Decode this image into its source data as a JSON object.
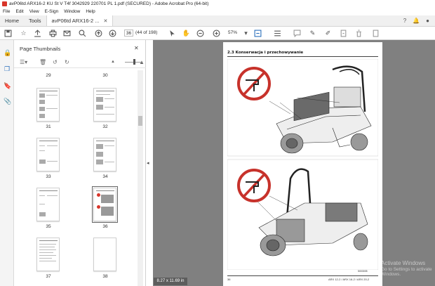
{
  "window": {
    "title": "avP06td ARX16-2 KU St V T4f 3042929 220701 PL 1.pdf (SECURED) - Adobe Acrobat Pro (64-bit)"
  },
  "menu": [
    "File",
    "Edit",
    "View",
    "E-Sign",
    "Window",
    "Help"
  ],
  "tabs": [
    {
      "label": "Home"
    },
    {
      "label": "Tools"
    },
    {
      "label": "avP06td ARX16-2 ..."
    }
  ],
  "toolbar": {
    "page_current": "36",
    "page_total": "(44 of 198)",
    "zoom": "57%"
  },
  "panel": {
    "title": "Page Thumbnails"
  },
  "thumbnails": [
    {
      "label": "29"
    },
    {
      "label": "30"
    },
    {
      "label": "31"
    },
    {
      "label": "32"
    },
    {
      "label": "33"
    },
    {
      "label": "34"
    },
    {
      "label": "35"
    },
    {
      "label": "36"
    },
    {
      "label": "37"
    },
    {
      "label": "38"
    }
  ],
  "document": {
    "section": "2.3     Konserwacja i przechowywanie",
    "figure_code": "5003005",
    "footer_page": "36",
    "footer_right": "ARX 12-2 / ARX 16-2 / ARX 20-2"
  },
  "status": {
    "page_size": "8.27 x 11.69 in"
  },
  "watermark": {
    "line1": "Activate Windows",
    "line2": "Go to Settings to activate Windows."
  }
}
